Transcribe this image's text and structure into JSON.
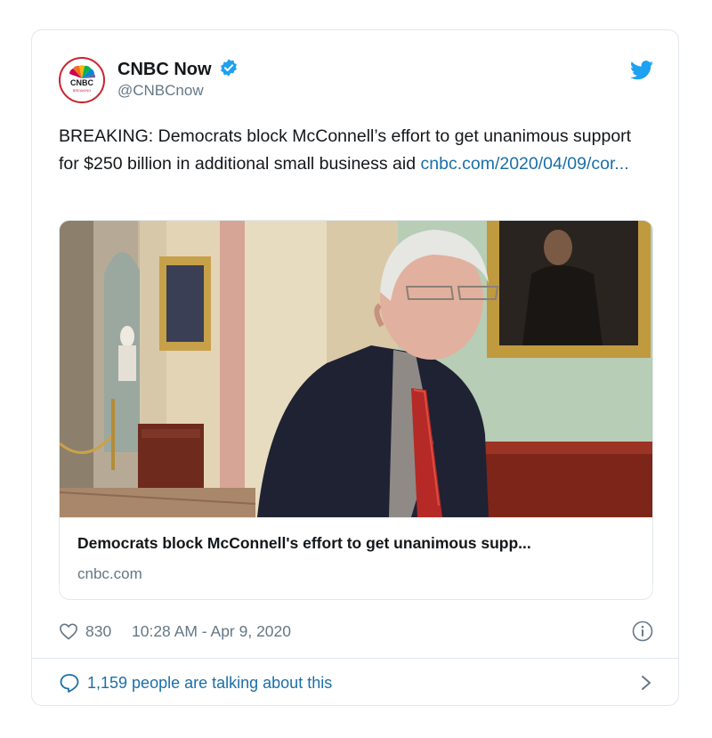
{
  "author": {
    "display_name": "CNBC Now",
    "handle": "@CNBCnow",
    "avatar_text": "CNBC",
    "avatar_subtext": "BREAKING",
    "verified": true
  },
  "tweet": {
    "text": "BREAKING: Democrats block McConnell’s effort to get unanimous support for $250 billion in additional small business aid ",
    "link_text": "cnbc.com/2020/04/09/cor..."
  },
  "card": {
    "title": "Democrats block McConnell's effort to get unanimous supp...",
    "domain": "cnbc.com"
  },
  "meta": {
    "likes": "830",
    "timestamp": "10:28 AM - Apr 9, 2020"
  },
  "footer": {
    "talking_label": "1,159 people are talking about this"
  },
  "colors": {
    "brand_blue": "#1da1f2",
    "link_blue": "#1b6fa7",
    "text": "#14171a",
    "muted": "#657786",
    "border": "#e1e8ed"
  },
  "icons": [
    "verified-badge-icon",
    "twitter-bird-icon",
    "heart-icon",
    "info-icon",
    "speech-bubble-icon",
    "chevron-right-icon"
  ]
}
